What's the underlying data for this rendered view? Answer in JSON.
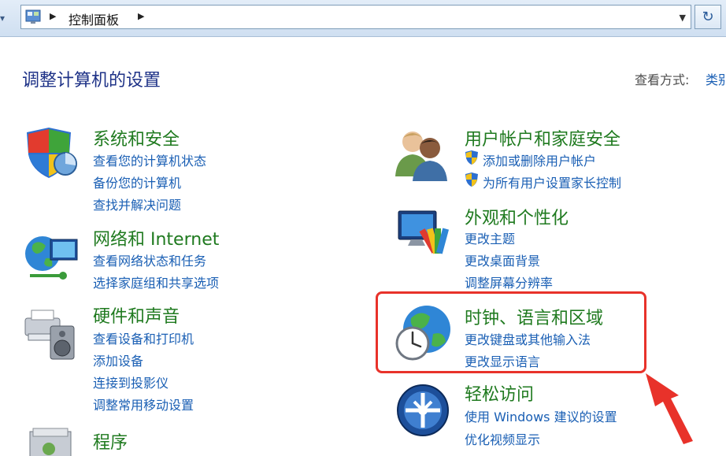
{
  "address_bar": {
    "crumb": "控制面板"
  },
  "page_title": "调整计算机的设置",
  "view_by": {
    "label": "查看方式:",
    "value": "类别"
  },
  "categories": {
    "system_security": {
      "title": "系统和安全",
      "links": [
        "查看您的计算机状态",
        "备份您的计算机",
        "查找并解决问题"
      ]
    },
    "network": {
      "title": "网络和 Internet",
      "links": [
        "查看网络状态和任务",
        "选择家庭组和共享选项"
      ]
    },
    "hardware": {
      "title": "硬件和声音",
      "links": [
        "查看设备和打印机",
        "添加设备",
        "连接到投影仪",
        "调整常用移动设置"
      ]
    },
    "programs": {
      "title": "程序"
    },
    "user_accounts": {
      "title": "用户帐户和家庭安全",
      "links": [
        "添加或删除用户帐户",
        "为所有用户设置家长控制"
      ]
    },
    "appearance": {
      "title": "外观和个性化",
      "links": [
        "更改主题",
        "更改桌面背景",
        "调整屏幕分辨率"
      ]
    },
    "clock_region": {
      "title": "时钟、语言和区域",
      "links": [
        "更改键盘或其他输入法",
        "更改显示语言"
      ]
    },
    "ease_access": {
      "title": "轻松访问",
      "links": [
        "使用 Windows 建议的设置",
        "优化视频显示"
      ]
    }
  },
  "colors": {
    "title": "#1e3287",
    "category": "#1f7a1f",
    "link": "#1a5fb4",
    "highlight": "#e8322a"
  }
}
